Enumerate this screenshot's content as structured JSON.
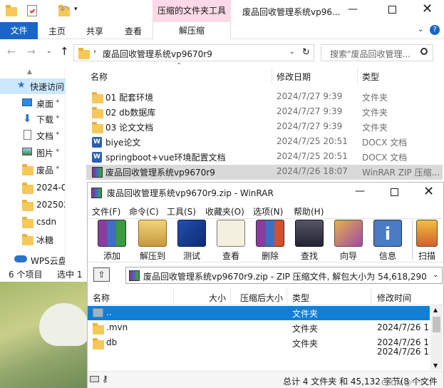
{
  "explorer": {
    "ribbon_tabs": {
      "file": "文件",
      "home": "主页",
      "share": "共享",
      "view": "查看",
      "extract": "解压缩"
    },
    "context_tab": "压缩的文件夹工具",
    "title": "废品回收管理系统vp96...",
    "breadcrumb": "废品回收管理系统vp9670r9",
    "search_placeholder": "搜索\"废品回收管理...",
    "col_name": "名称",
    "col_date": "修改日期",
    "col_type": "类型",
    "files": [
      {
        "name": "01 配套环境",
        "date": "2024/7/27 9:39",
        "type": "文件夹"
      },
      {
        "name": "02 db数据库",
        "date": "2024/7/27 9:39",
        "type": "文件夹"
      },
      {
        "name": "03 论文文档",
        "date": "2024/7/27 9:39",
        "type": "文件夹"
      },
      {
        "name": "biye论文",
        "date": "2024/7/25 20:51",
        "type": "DOCX 文档"
      },
      {
        "name": "springboot+vue环境配置文档",
        "date": "2024/7/25 20:51",
        "type": "DOCX 文档"
      },
      {
        "name": "废品回收管理系统vp9670r9",
        "date": "2024/7/26 18:07",
        "type": "WinRAR ZIP 压缩..."
      }
    ],
    "nav": [
      "快速访问",
      "桌面",
      "下载",
      "文档",
      "图片",
      "废品",
      "2024-0",
      "202502",
      "csdn",
      "冰糖",
      "WPS云盘"
    ],
    "status": {
      "count": "6 个项目",
      "selected": "选中 1"
    }
  },
  "winrar": {
    "title": "废品回收管理系统vp9670r9.zip - WinRAR",
    "menu": [
      "文件(F)",
      "命令(C)",
      "工具(S)",
      "收藏夹(O)",
      "选项(N)",
      "帮助(H)"
    ],
    "toolbar": [
      "添加",
      "解压到",
      "测试",
      "查看",
      "删除",
      "查找",
      "向导",
      "信息",
      "扫描"
    ],
    "path": "废品回收管理系统vp9670r9.zip - ZIP 压缩文件, 解包大小为 54,618,290 字节",
    "cols": {
      "name": "名称",
      "size": "大小",
      "packed": "压缩后大小",
      "type": "类型",
      "modified": "修改时间"
    },
    "rows": [
      {
        "name": "..",
        "type": "文件夹",
        "modified": ""
      },
      {
        "name": ".mvn",
        "type": "文件夹",
        "modified": "2024/7/26 18"
      },
      {
        "name": "db",
        "type": "文件夹",
        "modified": "2024/7/26 18"
      },
      {
        "name": "",
        "type": "",
        "modified": "2024/7/26 18"
      }
    ],
    "status": "总计 4 文件夹 和 45,132 字节(8 个文件",
    "watermark": "CSDN @一个..."
  }
}
